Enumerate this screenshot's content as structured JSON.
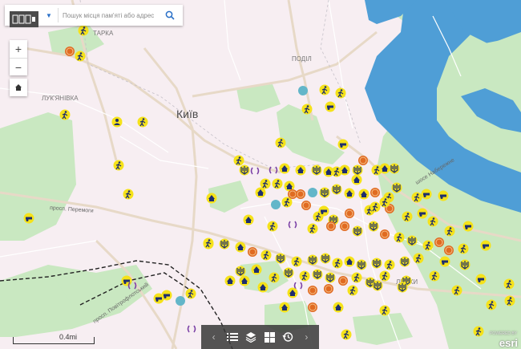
{
  "search": {
    "placeholder": "Пошук місця пам'яті або адреси"
  },
  "map_labels": {
    "city": "Київ",
    "podil": "ПОДІЛ",
    "lukianivka": "ЛУК'ЯНІВКА",
    "tatarka": "ТАРКА",
    "lypky": "ЛИПКИ",
    "prosp_peremohy": "просп. Перемоги",
    "prosp_povitroflotskyi": "просп. Повітрофлотський",
    "naberezhne": "шосе Набережне"
  },
  "scale": {
    "label": "0.4mi"
  },
  "attribution": {
    "brand": "esri",
    "text": "POWERED BY"
  },
  "colors": {
    "water": "#4f9ed6",
    "park": "#c9e8c1",
    "land": "#f7eef2",
    "marker_fill": "#f5e21a",
    "marker_navy": "#1e2e6e",
    "marker_brown": "#b36b2a",
    "marker_orange": "#e06b22",
    "marker_teal": "#63b6c9"
  },
  "icons": {
    "search": "search-icon",
    "zoom_in": "plus-icon",
    "zoom_out": "minus-icon",
    "home": "home-icon",
    "toolbar": [
      "chevron-left-icon",
      "list-icon",
      "layers-icon",
      "basemap-icon",
      "history-icon",
      "chevron-right-icon"
    ]
  }
}
